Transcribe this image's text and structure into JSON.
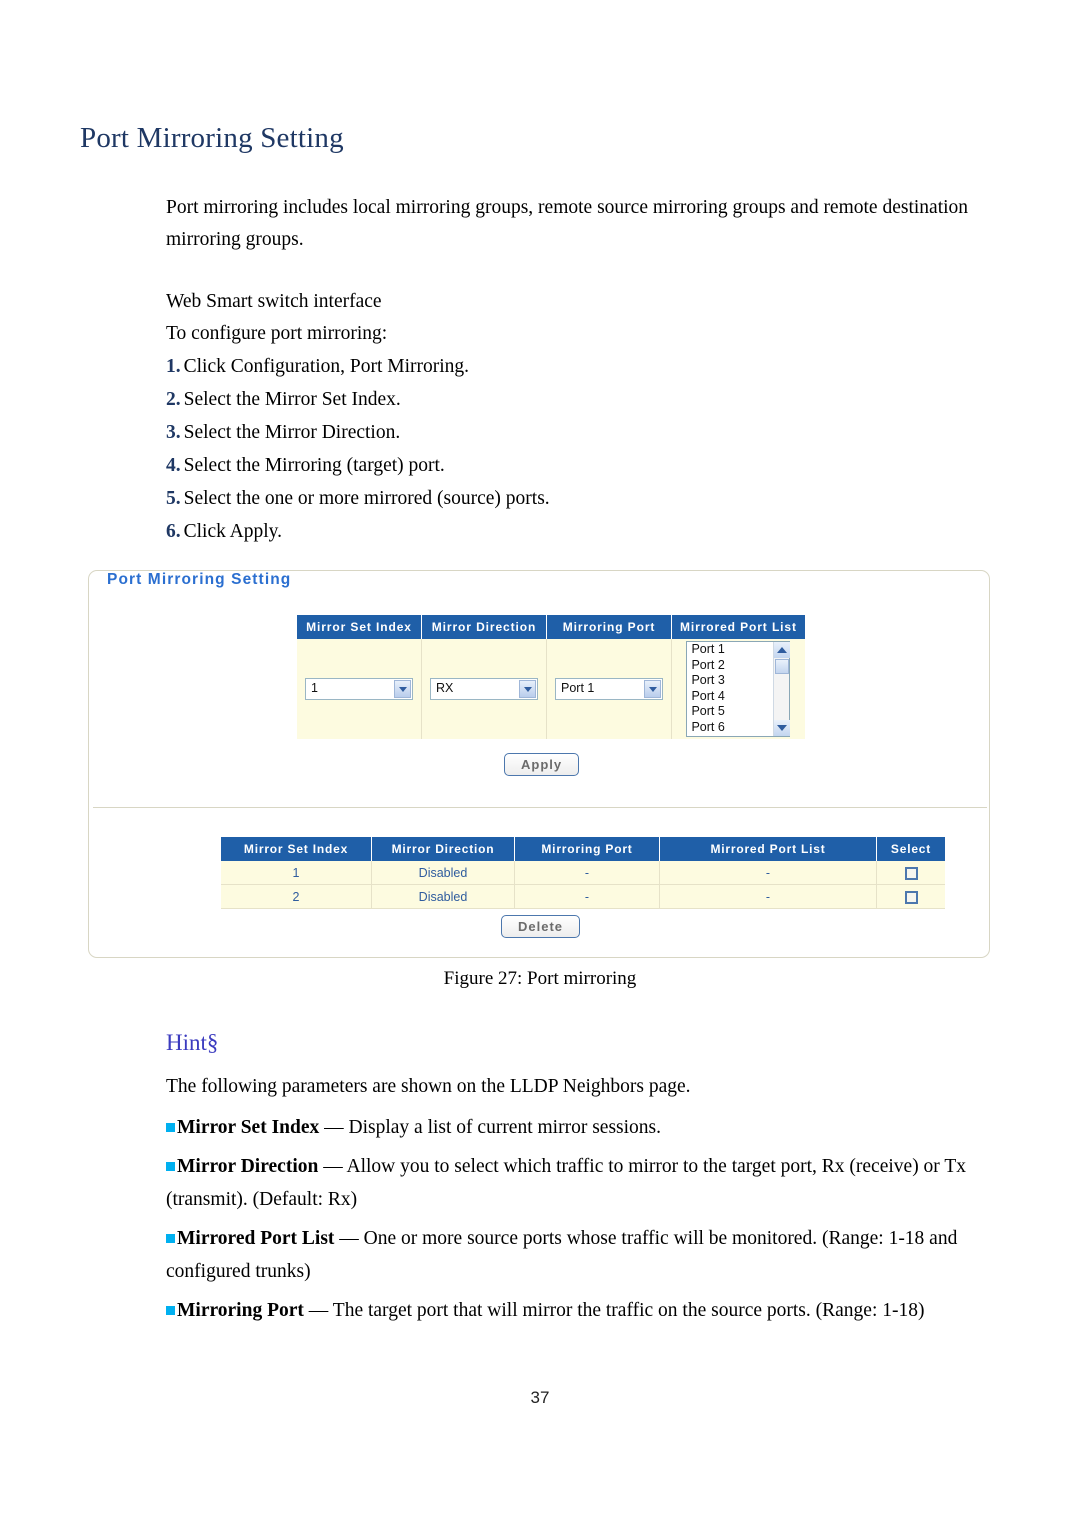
{
  "document": {
    "title": "Port Mirroring Setting",
    "intro_paragraph": "Port mirroring includes local mirroring groups, remote source mirroring groups and remote destination mirroring groups.",
    "interface_line": "Web Smart switch interface",
    "instruction_lead": "To configure port mirroring:",
    "steps": [
      {
        "num": "1.",
        "text": "Click Configuration, Port Mirroring."
      },
      {
        "num": "2.",
        "text": "Select the Mirror Set Index."
      },
      {
        "num": "3.",
        "text": "Select the Mirror Direction."
      },
      {
        "num": "4.",
        "text": "Select the Mirroring (target) port."
      },
      {
        "num": "5.",
        "text": "Select the one or more mirrored (source) ports."
      },
      {
        "num": "6.",
        "text": "Click Apply."
      }
    ],
    "figure_caption": "Figure 27: Port mirroring",
    "page_number": "37"
  },
  "figure": {
    "legend": "Port Mirroring Setting",
    "form": {
      "headers": [
        "Mirror Set Index",
        "Mirror Direction",
        "Mirroring Port",
        "Mirrored Port List"
      ],
      "mirror_set_index_value": "1",
      "mirror_direction_value": "RX",
      "mirroring_port_value": "Port 1",
      "mirrored_port_list_options": [
        "Port 1",
        "Port 2",
        "Port 3",
        "Port 4",
        "Port 5",
        "Port 6"
      ]
    },
    "apply_label": "Apply",
    "delete_label": "Delete",
    "results": {
      "headers": [
        "Mirror Set Index",
        "Mirror Direction",
        "Mirroring Port",
        "Mirrored Port List",
        "Select"
      ],
      "rows": [
        {
          "index": "1",
          "direction": "Disabled",
          "mirroring_port": "-",
          "mirrored_port_list": "-"
        },
        {
          "index": "2",
          "direction": "Disabled",
          "mirroring_port": "-",
          "mirrored_port_list": "-"
        }
      ]
    }
  },
  "hint": {
    "title": "Hint§",
    "lead": "The following parameters are shown on the LLDP Neighbors page.",
    "bullets": [
      {
        "term": "Mirror Set Index",
        "desc": " — Display a list of current mirror sessions."
      },
      {
        "term": "Mirror Direction",
        "desc": " — Allow you to select which traffic to mirror to the target port, Rx (receive) or Tx (transmit). (Default: Rx)"
      },
      {
        "term": "Mirrored Port List",
        "desc": " — One or more source ports whose traffic will be monitored. (Range: 1-18 and configured trunks)"
      },
      {
        "term": "Mirroring Port",
        "desc": " — The target port that will mirror the traffic on the source ports. (Range: 1-18)"
      }
    ]
  },
  "colors": {
    "heading_blue": "#1f3864",
    "table_header_blue": "#1f5fa8",
    "cell_cream": "#fdfbe0",
    "bullet_cyan": "#00b0f0"
  }
}
